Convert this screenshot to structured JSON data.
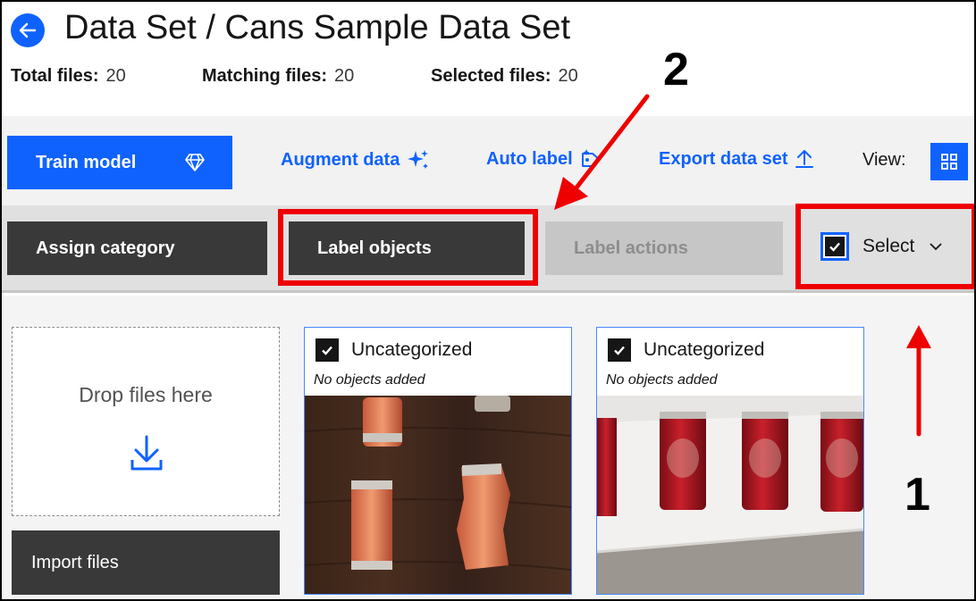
{
  "header": {
    "title": "Data Set / Cans Sample Data Set",
    "stats": [
      {
        "label": "Total files:",
        "value": "20"
      },
      {
        "label": "Matching files:",
        "value": "20"
      },
      {
        "label": "Selected files:",
        "value": "20"
      }
    ]
  },
  "toolbar": {
    "train_label": "Train model",
    "augment_label": "Augment data",
    "autolabel_label": "Auto label",
    "export_label": "Export data set",
    "view_label": "View:"
  },
  "actions": {
    "assign_label": "Assign category",
    "label_objects_label": "Label objects",
    "label_actions_label": "Label actions",
    "select_label": "Select"
  },
  "dropzone": {
    "text": "Drop files here",
    "import_label": "Import files"
  },
  "cards": [
    {
      "category": "Uncategorized",
      "objects": "No objects added",
      "checked": true
    },
    {
      "category": "Uncategorized",
      "objects": "No objects added",
      "checked": true
    }
  ],
  "annotations": {
    "callout_1": "1",
    "callout_2": "2"
  },
  "colors": {
    "primary": "#0f62fe",
    "dark_button": "#393939",
    "disabled_button": "#c6c6c6",
    "annotation_red": "#ee0000"
  }
}
